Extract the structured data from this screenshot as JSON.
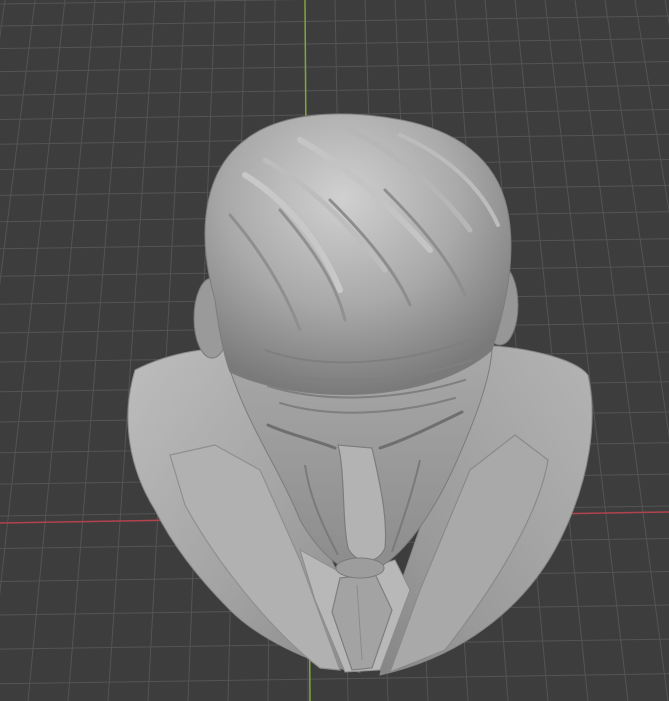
{
  "viewport": {
    "background_color": "#3d3d3d",
    "grid_color": "#545454",
    "x_axis_color": "#b2424e",
    "y_axis_color": "#7fa83a"
  },
  "model": {
    "subject": "sculpted-bust",
    "clay_color": "#9e9e9e",
    "highlight_color": "#cfcfcf",
    "shadow_color": "#6f6f6f"
  }
}
